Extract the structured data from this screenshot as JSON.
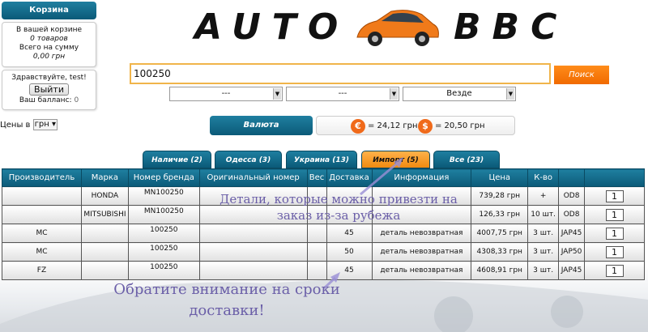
{
  "cart": {
    "title": "Корзина",
    "line1": "В вашей корзине",
    "count": "0 товаров",
    "sum_label": "Всего на сумму",
    "sum": "0,00 грн"
  },
  "user": {
    "greeting": "Здравствуйте, test!",
    "exit_label": "Выйти",
    "balance_label": "Ваш балланс:",
    "balance_value": "0"
  },
  "prices": {
    "label": "Цены в",
    "currency": "грн"
  },
  "logo": {
    "left": "AUTO",
    "right": "BBC"
  },
  "search": {
    "value": "100250",
    "button": "Поиск"
  },
  "filters": [
    {
      "value": "---"
    },
    {
      "value": "---"
    },
    {
      "value": "Везде"
    }
  ],
  "currency": {
    "button": "Валюта",
    "euro_symbol": "€",
    "euro_rate": "= 24,12 грн",
    "usd_symbol": "$",
    "usd_rate": "= 20,50 грн"
  },
  "tabs": [
    {
      "label": "Наличие (2)",
      "active": false
    },
    {
      "label": "Одесса (3)",
      "active": false
    },
    {
      "label": "Украина (13)",
      "active": false
    },
    {
      "label": "Импорт (5)",
      "active": true
    },
    {
      "label": "Все (23)",
      "active": false
    }
  ],
  "table": {
    "headers": [
      "Производитель",
      "Марка",
      "Номер бренда",
      "Оригинальный номер",
      "Вес",
      "Доставка",
      "Информация",
      "Цена",
      "К-во",
      "",
      ""
    ],
    "rows": [
      {
        "maker": "",
        "brand": "HONDA",
        "brand_no": "MN100250",
        "orig": "",
        "weight": "",
        "delivery": "",
        "info": "",
        "price": "739,28 грн",
        "qty": "+",
        "wh": "OD8",
        "order": "1"
      },
      {
        "maker": "",
        "brand": "MITSUBISHI",
        "brand_no": "MN100250",
        "orig": "",
        "weight": "",
        "delivery": "",
        "info": "",
        "price": "126,33 грн",
        "qty": "10 шт.",
        "wh": "OD8",
        "order": "1"
      },
      {
        "maker": "MC",
        "brand": "",
        "brand_no": "100250",
        "orig": "",
        "weight": "",
        "delivery": "45",
        "info": "деталь невозвратная",
        "price": "4007,75 грн",
        "qty": "3 шт.",
        "wh": "JAP45",
        "order": "1"
      },
      {
        "maker": "MC",
        "brand": "",
        "brand_no": "100250",
        "orig": "",
        "weight": "",
        "delivery": "50",
        "info": "деталь невозвратная",
        "price": "4308,33 грн",
        "qty": "3 шт.",
        "wh": "JAP50",
        "order": "1"
      },
      {
        "maker": "FZ",
        "brand": "",
        "brand_no": "100250",
        "orig": "",
        "weight": "",
        "delivery": "45",
        "info": "деталь невозвратная",
        "price": "4608,91 грн",
        "qty": "3 шт.",
        "wh": "JAP45",
        "order": "1"
      }
    ]
  },
  "annotations": {
    "import_note": "Детали, которые можно привезти на заказ из-за рубежа",
    "delivery_note": "Обратите внимание на сроки доставки!"
  },
  "colors": {
    "header_blue": "#0b5a78",
    "active_tab_orange": "#f08a10",
    "search_orange": "#f06a00",
    "annotation_purple": "#6b5fa8"
  }
}
